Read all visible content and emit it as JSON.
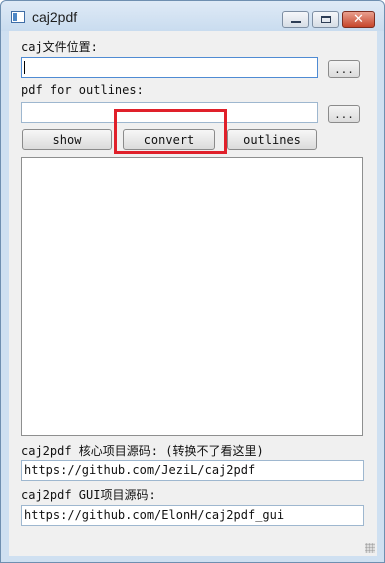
{
  "window": {
    "title": "caj2pdf",
    "icon": "app-window-icon"
  },
  "form": {
    "caj_label": "caj文件位置:",
    "caj_value": "",
    "pdf_label": "pdf for outlines:",
    "pdf_value": "",
    "browse_label": "...",
    "show_label": "show",
    "convert_label": "convert",
    "outlines_label": "outlines"
  },
  "output_text": "",
  "footer": {
    "core_label": "caj2pdf 核心项目源码: (转换不了看这里)",
    "core_url": "https://github.com/JeziL/caj2pdf",
    "gui_label": "caj2pdf GUI项目源码:",
    "gui_url": "https://github.com/ElonH/caj2pdf_gui"
  },
  "colors": {
    "highlight": "#e0202a",
    "close_button": "#c6452a"
  }
}
